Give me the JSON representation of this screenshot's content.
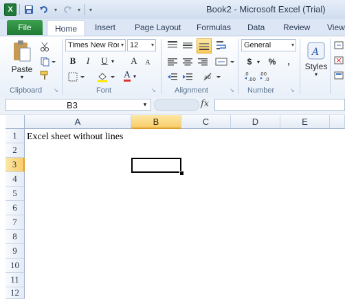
{
  "window": {
    "title": "Book2 - Microsoft Excel (Trial)"
  },
  "qat": {
    "logo": "X",
    "save_icon": "save-icon",
    "undo_icon": "undo-icon",
    "redo_icon": "redo-icon",
    "customize_icon": "customize-qat-icon"
  },
  "ribbon_tabs": [
    {
      "label": "File"
    },
    {
      "label": "Home"
    },
    {
      "label": "Insert"
    },
    {
      "label": "Page Layout"
    },
    {
      "label": "Formulas"
    },
    {
      "label": "Data"
    },
    {
      "label": "Review"
    },
    {
      "label": "View"
    }
  ],
  "clipboard": {
    "paste_label": "Paste",
    "group_label": "Clipboard"
  },
  "font": {
    "name": "Times New Roman",
    "size": "12",
    "bold": "B",
    "italic": "I",
    "underline": "U",
    "grow": "A",
    "shrink": "A",
    "font_color": "A",
    "group_label": "Font",
    "font_color_hex": "#e0302a",
    "fill_color_hex": "#ffe600"
  },
  "alignment": {
    "group_label": "Alignment"
  },
  "number": {
    "format": "General",
    "currency": "$",
    "percent": "%",
    "comma": ",",
    "inc_decimal": ".0 .00",
    "dec_decimal": ".00 .0",
    "group_label": "Number"
  },
  "styles": {
    "label": "Styles"
  },
  "formula_bar": {
    "name_box": "B3",
    "fx": "fx",
    "formula": ""
  },
  "sheet": {
    "columns": [
      "A",
      "B",
      "C",
      "D",
      "E"
    ],
    "rows": [
      "1",
      "2",
      "3",
      "4",
      "5",
      "6",
      "7",
      "8",
      "9",
      "10",
      "11",
      "12"
    ],
    "selected_column": "B",
    "selected_row": "3",
    "cell_A1": "Excel sheet without lines"
  }
}
